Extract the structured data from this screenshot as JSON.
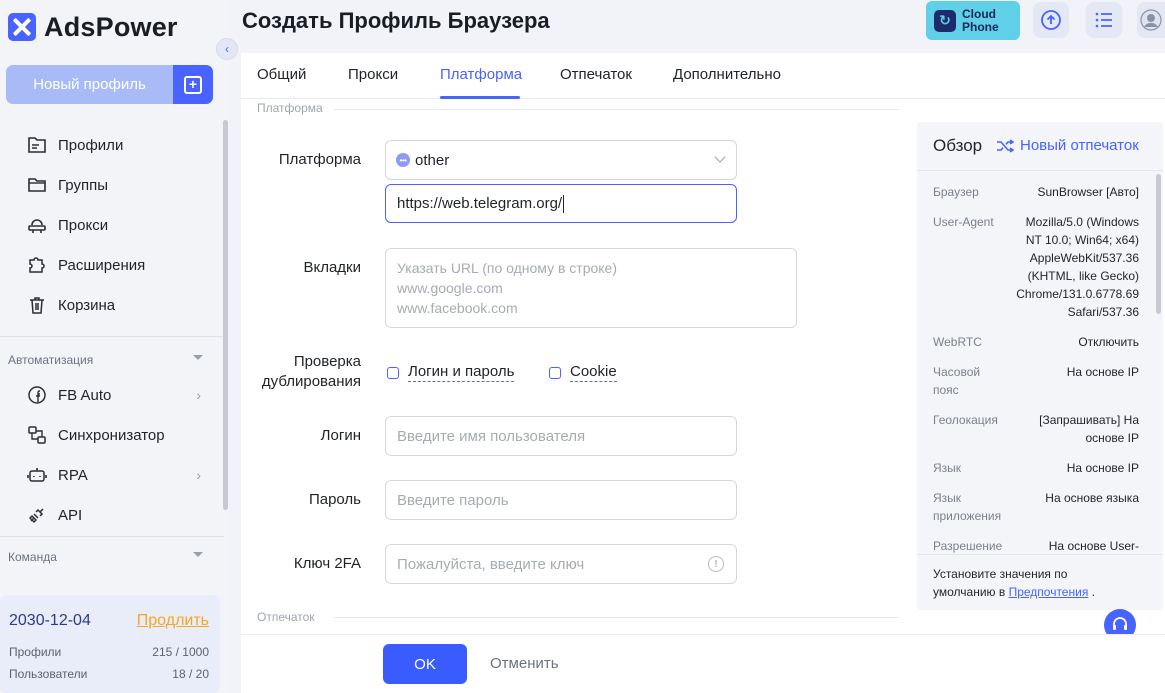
{
  "app": {
    "name": "AdsPower"
  },
  "sidebar": {
    "new_profile_label": "Новый профиль",
    "nav": [
      {
        "label": "Профили",
        "icon": "profiles-icon"
      },
      {
        "label": "Группы",
        "icon": "folder-icon"
      },
      {
        "label": "Прокси",
        "icon": "proxy-icon"
      },
      {
        "label": "Расширения",
        "icon": "puzzle-icon"
      },
      {
        "label": "Корзина",
        "icon": "trash-icon"
      }
    ],
    "automation_label": "Автоматизация",
    "automation": [
      {
        "label": "FB Auto",
        "icon": "facebook-icon"
      },
      {
        "label": "Синхронизатор",
        "icon": "sync-icon"
      },
      {
        "label": "RPA",
        "icon": "robot-icon"
      },
      {
        "label": "API",
        "icon": "plug-icon"
      }
    ],
    "team_label": "Команда",
    "subscription": {
      "date": "2030-12-04",
      "renew": "Продлить",
      "profiles_label": "Профили",
      "profiles_value": "215 / 1000",
      "users_label": "Пользователи",
      "users_value": "18 / 20"
    }
  },
  "header": {
    "title": "Создать Профиль Браузера",
    "cloud_phone_line1": "Cloud",
    "cloud_phone_line2": "Phone"
  },
  "tabs": [
    "Общий",
    "Прокси",
    "Платформа",
    "Отпечаток",
    "Дополнительно"
  ],
  "active_tab": "Платформа",
  "form": {
    "group_platform": "Платформа",
    "group_fingerprint": "Отпечаток",
    "platform_label": "Платформа",
    "platform_value": "other",
    "platform_url": "https://web.telegram.org/",
    "tabs_label": "Вкладки",
    "tabs_placeholder_1": "Указать URL (по одному в строке)",
    "tabs_placeholder_2": "www.google.com",
    "tabs_placeholder_3": "www.facebook.com",
    "dup_label_1": "Проверка",
    "dup_label_2": "дублирования",
    "dup_login": "Логин и пароль",
    "dup_cookie": "Cookie",
    "login_label": "Логин",
    "login_placeholder": "Введите имя пользователя",
    "password_label": "Пароль",
    "password_placeholder": "Введите пароль",
    "twofa_label": "Ключ 2FA",
    "twofa_placeholder": "Пожалуйста, введите ключ"
  },
  "overview": {
    "title": "Обзор",
    "new_fingerprint": "Новый отпечаток",
    "rows": [
      {
        "k": "Браузер",
        "v": "SunBrowser [Авто]"
      },
      {
        "k": "User-Agent",
        "v": "Mozilla/5.0 (Windows NT 10.0; Win64; x64) AppleWebKit/537.36 (KHTML, like Gecko) Chrome/131.0.6778.69 Safari/537.36"
      },
      {
        "k": "WebRTC",
        "v": "Отключить"
      },
      {
        "k": "Часовой пояс",
        "v": "На основе IP"
      },
      {
        "k": "Геолокация",
        "v": "[Запрашивать] На основе IP"
      },
      {
        "k": "Язык",
        "v": "На основе IP"
      },
      {
        "k": "Язык приложения",
        "v": "На основе языка"
      },
      {
        "k": "Разрешение",
        "v": "На основе User-"
      }
    ],
    "note_text": "Установите значения по умолчанию в",
    "note_link": "Предпочтения",
    "note_end": "."
  },
  "footer": {
    "ok": "OK",
    "cancel": "Отменить"
  },
  "colors": {
    "accent": "#4863ff",
    "renew": "#f5a623",
    "cloud_phone": "#5fd0e8"
  }
}
